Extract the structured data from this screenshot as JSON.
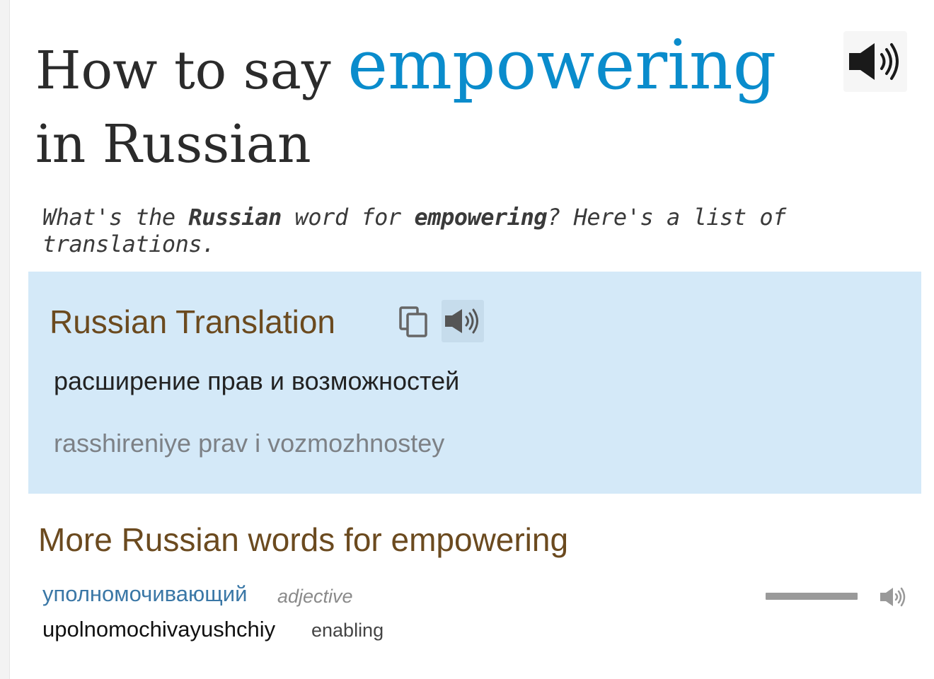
{
  "header": {
    "title_prefix": "How to say",
    "title_word": "empowering",
    "title_suffix": "in Russian",
    "speaker_icon": "speaker-icon"
  },
  "subtitle": {
    "part1": "What's the ",
    "language": "Russian",
    "part2": " word for ",
    "word": "empowering",
    "part3": "? Here's a list of translations."
  },
  "translation": {
    "heading": "Russian Translation",
    "copy_icon": "copy-icon",
    "speaker_icon": "speaker-icon",
    "cyrillic": "расширение прав и возможностей",
    "transliteration": "rasshireniye prav i vozmozhnostey"
  },
  "more_words": {
    "heading": "More Russian words for empowering",
    "items": [
      {
        "russian": "уполномочивающий",
        "part_of_speech": "adjective",
        "transliteration": "upolnomochivayushchiy",
        "gloss": "enabling",
        "frequency": 1.0,
        "speaker_icon": "speaker-icon"
      }
    ]
  },
  "colors": {
    "accent": "#0a8ccc",
    "heading_brown": "#6b4a1f",
    "box_bg": "#d4e9f8",
    "link_blue": "#3a77a6"
  }
}
